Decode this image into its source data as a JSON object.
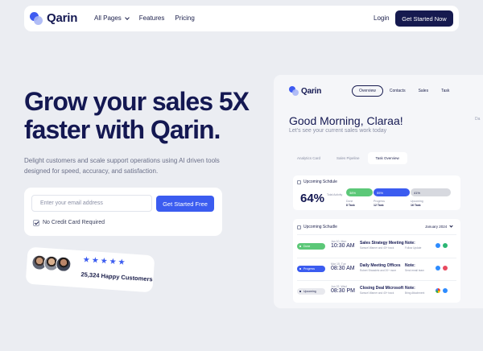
{
  "nav": {
    "brand": "Qarin",
    "links": [
      "All Pages",
      "Features",
      "Pricing"
    ],
    "login": "Login",
    "cta": "Get Started Now"
  },
  "hero": {
    "headline": "Grow your sales 5X faster with Qarin.",
    "subtext": "Delight customers and scale support operations using AI driven tools designed for speed, accuracy, and satisfaction.",
    "email_placeholder": "Enter your email address",
    "cta": "Get Started Free",
    "no_card": "No Credit Card Required",
    "rating_stars": 5,
    "happy_customers": "25,324 Happy Customers"
  },
  "dashboard": {
    "brand": "Qarin",
    "tabs": [
      "Overview",
      "Contacts",
      "Sales",
      "Task"
    ],
    "active_tab": "Overview",
    "greeting": "Good Morning, Claraa!",
    "greeting_sub": "Let's see your current sales work today",
    "search_hint": "Da",
    "sub_tabs": [
      "Analytics Card",
      "Sales Pipeline",
      "Task Overview"
    ],
    "upcoming": {
      "title": "Upcoming Schdule",
      "percent": "64%",
      "percent_label": "Total Activity",
      "bars": [
        {
          "value": "38%",
          "label": "Done",
          "count": "8 Task"
        },
        {
          "value": "55%",
          "label": "Progress",
          "count": "12 Task"
        },
        {
          "value": "41%",
          "label": "Upcoming",
          "count": "16 Task"
        }
      ]
    },
    "schedule": {
      "title": "Upcoming Schudle",
      "month": "January 2024",
      "rows": [
        {
          "status": "Done",
          "date": "Jan 10, Mon",
          "time": "10:30 AM",
          "title": "Sales Strategy Meeting",
          "people": "Samuel Warner and 40+ track",
          "note_label": "Note:",
          "note": "Follow Update"
        },
        {
          "status": "Progress",
          "date": "Mar 15, Tue",
          "time": "08:30 AM",
          "title": "Daily Meeting Offices",
          "people": "Robert Shwadetz and 20+ more",
          "note_label": "Note:",
          "note": "Send email team"
        },
        {
          "status": "Upcoming",
          "date": "Jun 22, Wed",
          "time": "08:30 PM",
          "title": "Closing Deal Microsoft",
          "people": "Samuel Warner and 40+ track",
          "note_label": "Note:",
          "note": "Bring Attachment"
        }
      ]
    }
  }
}
